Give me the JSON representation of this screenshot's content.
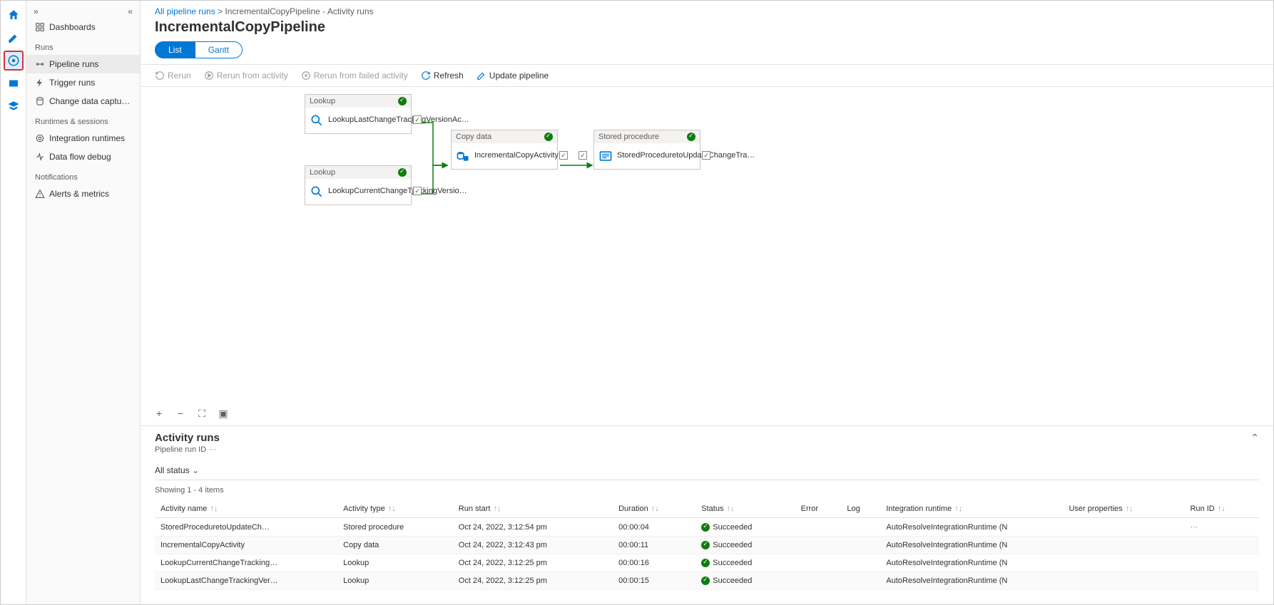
{
  "breadcrumb": {
    "link": "All pipeline runs",
    "current": "IncrementalCopyPipeline - Activity runs"
  },
  "title": "IncrementalCopyPipeline",
  "sidebar": {
    "sections": [
      {
        "label": "",
        "items": [
          {
            "label": "Dashboards",
            "icon": "dashboard"
          }
        ]
      },
      {
        "label": "Runs",
        "items": [
          {
            "label": "Pipeline runs",
            "icon": "pipeline",
            "active": true
          },
          {
            "label": "Trigger runs",
            "icon": "trigger"
          },
          {
            "label": "Change data capture (previ…",
            "icon": "cdc"
          }
        ]
      },
      {
        "label": "Runtimes & sessions",
        "items": [
          {
            "label": "Integration runtimes",
            "icon": "ir"
          },
          {
            "label": "Data flow debug",
            "icon": "dfd"
          }
        ]
      },
      {
        "label": "Notifications",
        "items": [
          {
            "label": "Alerts & metrics",
            "icon": "alert"
          }
        ]
      }
    ]
  },
  "tabs": {
    "list": "List",
    "gantt": "Gantt"
  },
  "toolbar": {
    "rerun": "Rerun",
    "rerun_activity": "Rerun from activity",
    "rerun_failed": "Rerun from failed activity",
    "refresh": "Refresh",
    "update": "Update pipeline"
  },
  "nodes": {
    "n1": {
      "type": "Lookup",
      "label": "LookupLastChangeTrackingVersionAc…"
    },
    "n2": {
      "type": "Lookup",
      "label": "LookupCurrentChangeTrackingVersio…"
    },
    "n3": {
      "type": "Copy data",
      "label": "IncrementalCopyActivity"
    },
    "n4": {
      "type": "Stored procedure",
      "label": "StoredProceduretoUpdateChangeTra…"
    }
  },
  "panel": {
    "title": "Activity runs",
    "sub": "Pipeline run ID",
    "filter": "All status",
    "count": "Showing 1 - 4 items",
    "cols": [
      "Activity name",
      "Activity type",
      "Run start",
      "Duration",
      "Status",
      "Error",
      "Log",
      "Integration runtime",
      "User properties",
      "Run ID"
    ],
    "rows": [
      {
        "name": "StoredProceduretoUpdateCh…",
        "type": "Stored procedure",
        "start": "Oct 24, 2022, 3:12:54 pm",
        "dur": "00:00:04",
        "status": "Succeeded",
        "ir": "AutoResolveIntegrationRuntime (N",
        "runid": "⋯"
      },
      {
        "name": "IncrementalCopyActivity",
        "type": "Copy data",
        "start": "Oct 24, 2022, 3:12:43 pm",
        "dur": "00:00:11",
        "status": "Succeeded",
        "ir": "AutoResolveIntegrationRuntime (N",
        "runid": ""
      },
      {
        "name": "LookupCurrentChangeTracking…",
        "type": "Lookup",
        "start": "Oct 24, 2022, 3:12:25 pm",
        "dur": "00:00:16",
        "status": "Succeeded",
        "ir": "AutoResolveIntegrationRuntime (N",
        "runid": ""
      },
      {
        "name": "LookupLastChangeTrackingVer…",
        "type": "Lookup",
        "start": "Oct 24, 2022, 3:12:25 pm",
        "dur": "00:00:15",
        "status": "Succeeded",
        "ir": "AutoResolveIntegrationRuntime (N",
        "runid": ""
      }
    ]
  }
}
